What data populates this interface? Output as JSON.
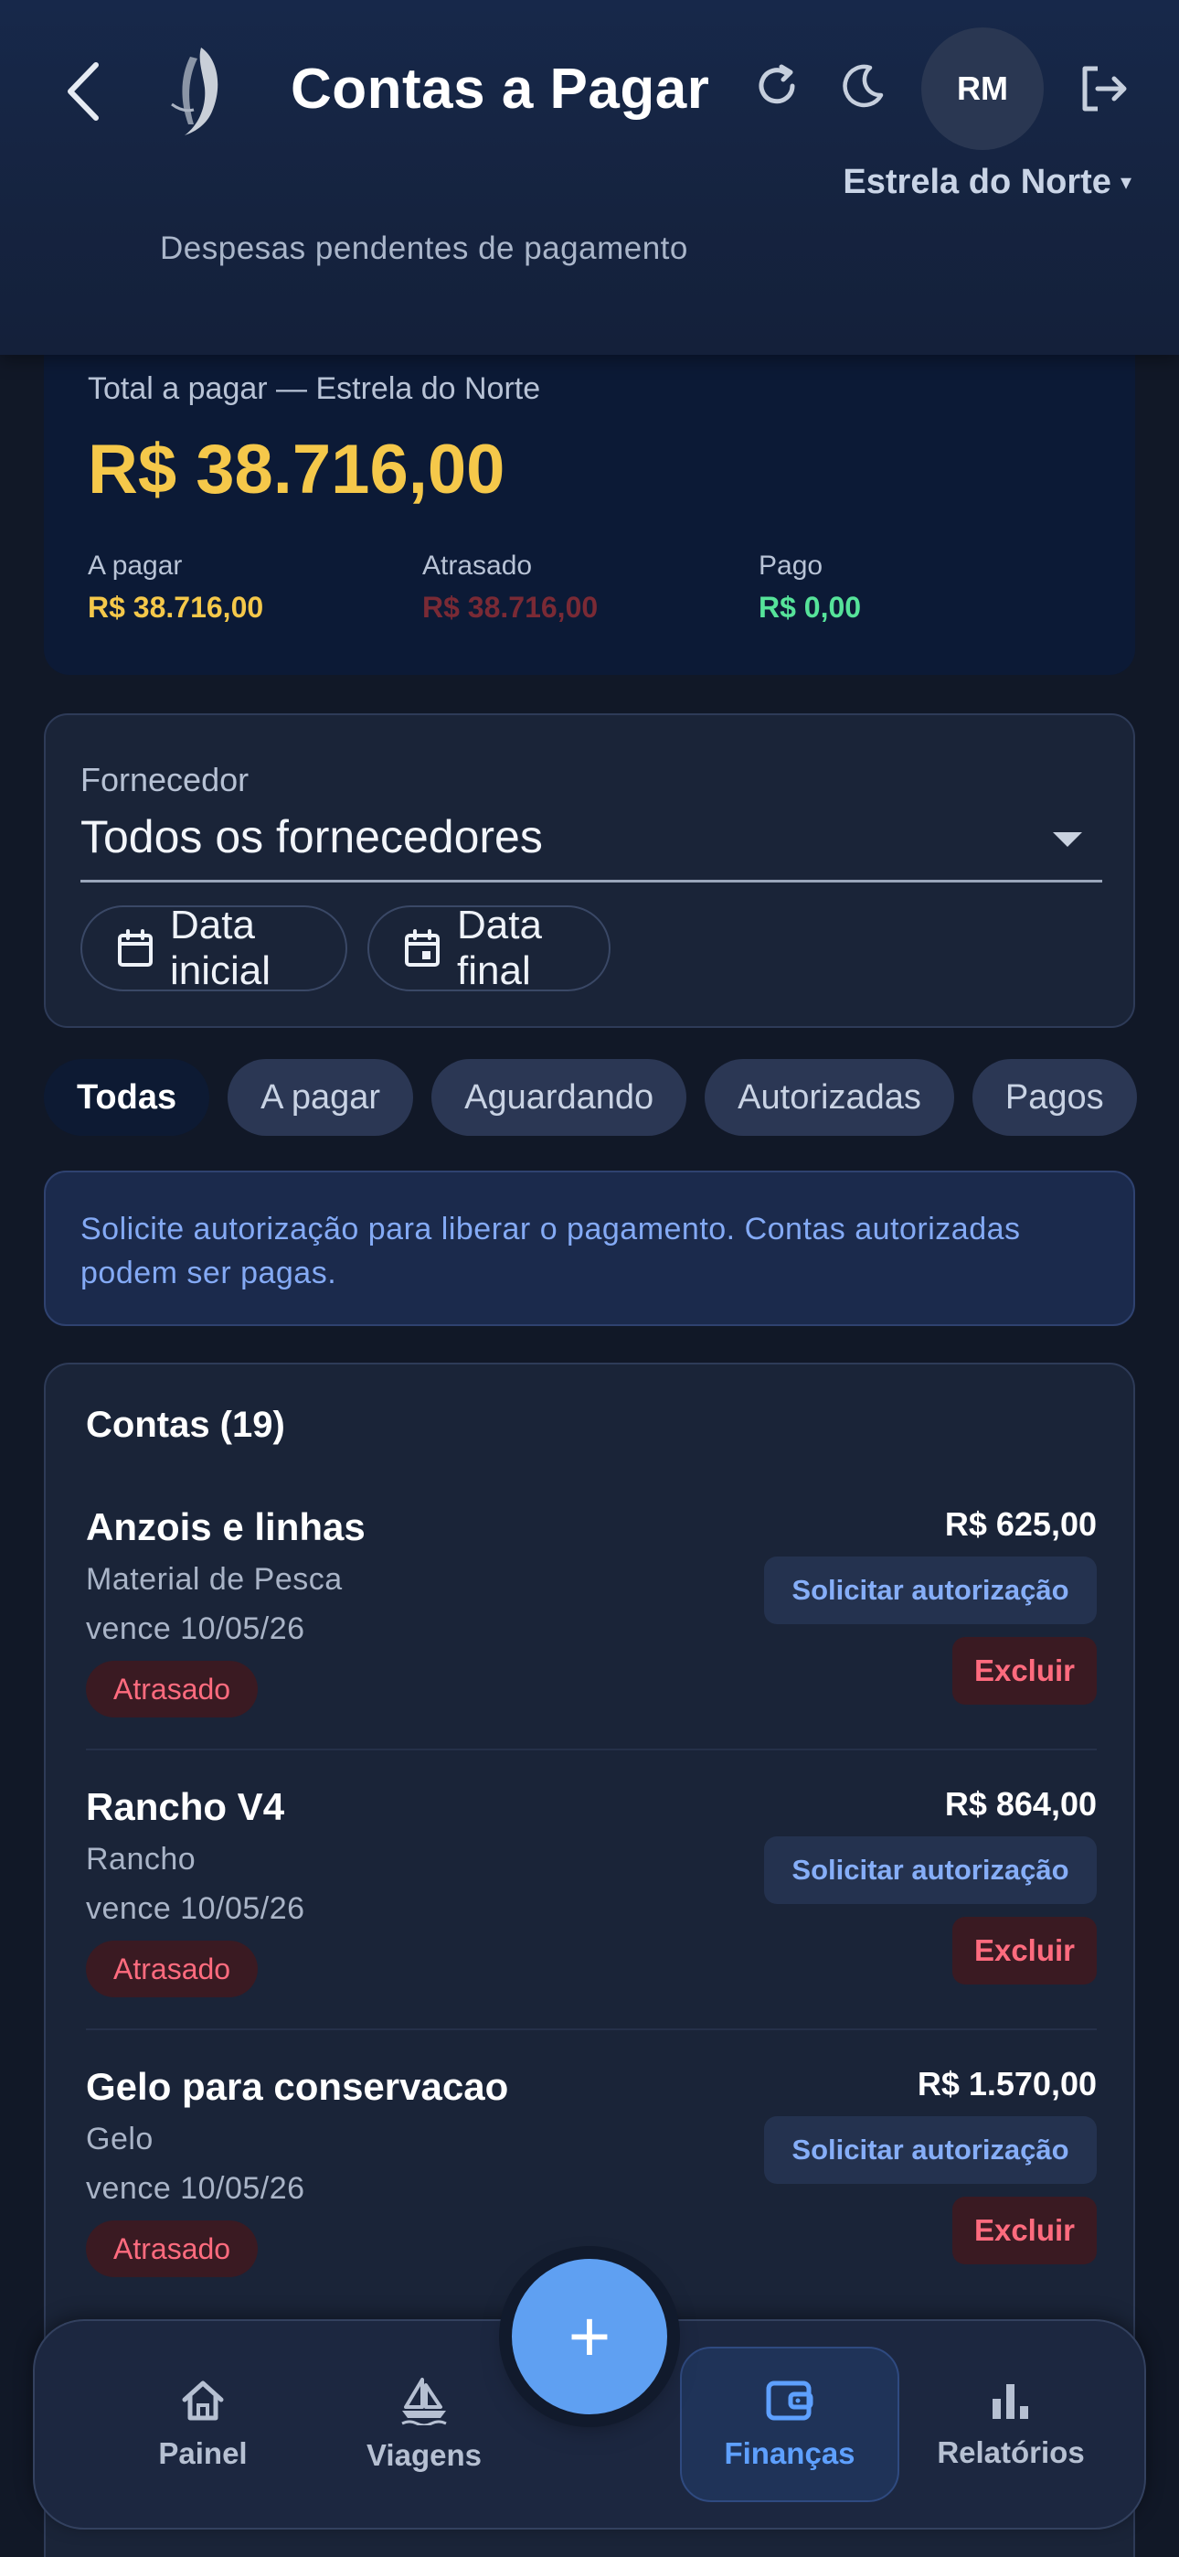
{
  "header": {
    "title": "Contas a Pagar",
    "subtitle": "Despesas pendentes de pagamento",
    "avatar_initials": "RM",
    "vessel": "Estrela do Norte",
    "vessel_caret": "▾"
  },
  "summary": {
    "total_label": "Total a pagar — Estrela do Norte",
    "total_value": "R$ 38.716,00",
    "stats": [
      {
        "label": "A pagar",
        "value": "R$ 38.716,00",
        "color": "#f5c84a"
      },
      {
        "label": "Atrasado",
        "value": "R$ 38.716,00",
        "color": "#7a2a35"
      },
      {
        "label": "Pago",
        "value": "R$ 0,00",
        "color": "#56e39a"
      }
    ]
  },
  "filter": {
    "supplier_label": "Fornecedor",
    "supplier_value": "Todos os fornecedores",
    "date_start": "Data inicial",
    "date_end": "Data final"
  },
  "tabs": [
    "Todas",
    "A pagar",
    "Aguardando",
    "Autorizadas",
    "Pagos"
  ],
  "info": "Solicite autorização para liberar o pagamento. Contas autorizadas podem ser pagas.",
  "accounts": {
    "title": "Contas (19)",
    "items": [
      {
        "name": "Anzois e linhas",
        "category": "Material de Pesca",
        "due": "vence 10/05/26",
        "status": "Atrasado",
        "amount": "R$ 625,00",
        "auth": "Solicitar autorização",
        "delete": "Excluir"
      },
      {
        "name": "Rancho V4",
        "category": "Rancho",
        "due": "vence 10/05/26",
        "status": "Atrasado",
        "amount": "R$ 864,00",
        "auth": "Solicitar autorização",
        "delete": "Excluir"
      },
      {
        "name": "Gelo para conservacao",
        "category": "Gelo",
        "due": "vence 10/05/26",
        "status": "Atrasado",
        "amount": "R$ 1.570,00",
        "auth": "Solicitar autorização",
        "delete": "Excluir"
      }
    ]
  },
  "fab": "+",
  "nav": [
    {
      "label": "Painel",
      "icon": "home-icon"
    },
    {
      "label": "Viagens",
      "icon": "boat-icon"
    },
    {
      "label": "Finanças",
      "icon": "wallet-icon",
      "active": true
    },
    {
      "label": "Relatórios",
      "icon": "bar-chart-icon"
    }
  ],
  "colors": {
    "accent": "#5fa0f2",
    "warning": "#f5c84a",
    "danger": "#ff6b7e",
    "success": "#56e39a"
  }
}
